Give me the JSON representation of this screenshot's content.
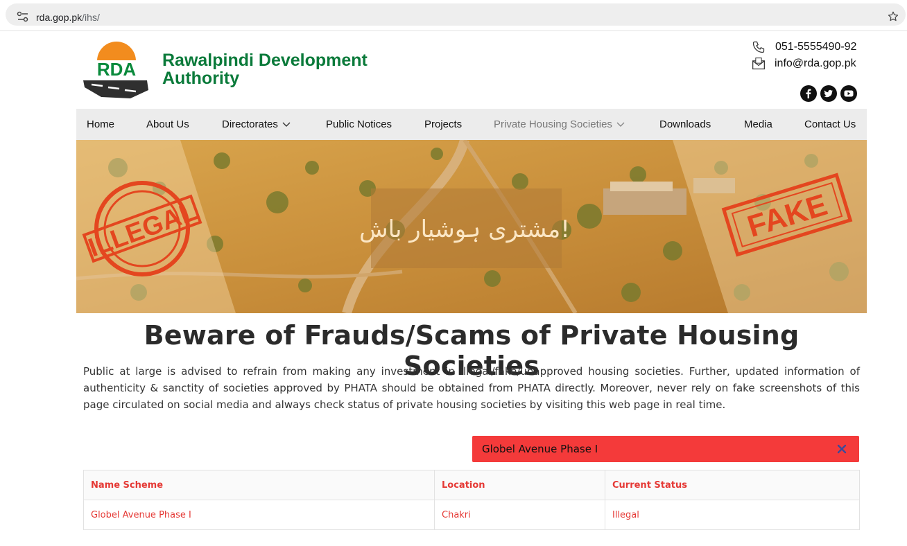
{
  "browser": {
    "url_domain": "rda.gop.pk",
    "url_path": "/ihs/"
  },
  "header": {
    "org_name": "Rawalpindi Development Authority",
    "logo_text": "RDA",
    "phone": "051-5555490-92",
    "email": "info@rda.gop.pk",
    "social": [
      "facebook-icon",
      "twitter-icon",
      "youtube-icon"
    ]
  },
  "nav": {
    "items": [
      {
        "label": "Home"
      },
      {
        "label": "About Us"
      },
      {
        "label": "Directorates",
        "dropdown": true
      },
      {
        "label": "Public Notices"
      },
      {
        "label": "Projects"
      },
      {
        "label": "Private Housing Societies",
        "dropdown": true,
        "active": true
      },
      {
        "label": "Downloads"
      },
      {
        "label": "Media"
      },
      {
        "label": "Contact Us"
      }
    ]
  },
  "banner": {
    "stamp_left": "ILLEGAL",
    "stamp_right": "FAKE",
    "urdu_caption": "مشتری ہوشیار باش!"
  },
  "main": {
    "headline": "Beware of Frauds/Scams of Private Housing Societies",
    "advisory": "Public at large is advised to refrain from making any investment in illegal/fake/unapproved housing societies. Further, updated information of authenticity & sanctity of societies approved by PHATA should be obtained from PHATA directly. Moreover, never rely on fake screenshots of this page circulated on social media and always check status of private housing societies by visiting this web page in real time."
  },
  "search": {
    "value": "Globel Avenue Phase I"
  },
  "table": {
    "headers": [
      "Name Scheme",
      "Location",
      "Current Status"
    ],
    "rows": [
      [
        "Globel Avenue Phase I",
        "Chakri",
        "Illegal"
      ]
    ]
  },
  "colors": {
    "brand_green": "#0a7a3a",
    "alert_red": "#f43a3a",
    "table_red": "#e53935"
  }
}
